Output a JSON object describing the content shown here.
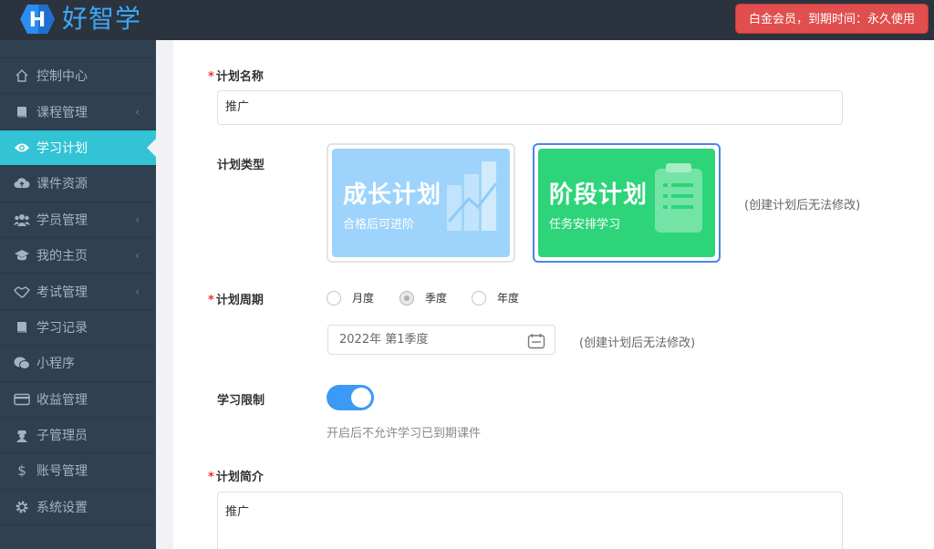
{
  "header": {
    "logo_letter": "H",
    "logo_text": "好智学",
    "member_status": "白金会员，到期时间：永久使用"
  },
  "sidebar": {
    "items": [
      {
        "label": "控制中心",
        "icon": "home-icon",
        "has_submenu": false,
        "active": false
      },
      {
        "label": "课程管理",
        "icon": "book-icon",
        "has_submenu": true,
        "active": false
      },
      {
        "label": "学习计划",
        "icon": "eye-icon",
        "has_submenu": false,
        "active": true
      },
      {
        "label": "课件资源",
        "icon": "cloud-icon",
        "has_submenu": false,
        "active": false
      },
      {
        "label": "学员管理",
        "icon": "users-icon",
        "has_submenu": true,
        "active": false
      },
      {
        "label": "我的主页",
        "icon": "graduation-cap-icon",
        "has_submenu": true,
        "active": false
      },
      {
        "label": "考试管理",
        "icon": "handshake-icon",
        "has_submenu": true,
        "active": false
      },
      {
        "label": "学习记录",
        "icon": "book-icon",
        "has_submenu": false,
        "active": false
      },
      {
        "label": "小程序",
        "icon": "wechat-icon",
        "has_submenu": false,
        "active": false
      },
      {
        "label": "收益管理",
        "icon": "credit-card-icon",
        "has_submenu": false,
        "active": false
      },
      {
        "label": "子管理员",
        "icon": "user-secret-icon",
        "has_submenu": false,
        "active": false
      },
      {
        "label": "账号管理",
        "icon": "dollar-icon",
        "has_submenu": false,
        "active": false
      },
      {
        "label": "系统设置",
        "icon": "gear-icon",
        "has_submenu": false,
        "active": false
      }
    ]
  },
  "form": {
    "plan_name": {
      "label": "计划名称",
      "value": "推广"
    },
    "plan_type": {
      "label": "计划类型",
      "hint": "(创建计划后无法修改)",
      "options": [
        {
          "title": "成长计划",
          "subtitle": "合格后可进阶",
          "selected": false
        },
        {
          "title": "阶段计划",
          "subtitle": "任务安排学习",
          "selected": true
        }
      ]
    },
    "plan_period": {
      "label": "计划周期",
      "options": [
        {
          "label": "月度",
          "checked": false
        },
        {
          "label": "季度",
          "checked": true
        },
        {
          "label": "年度",
          "checked": false
        }
      ],
      "date_value": "2022年 第1季度",
      "hint": "(创建计划后无法修改)"
    },
    "study_limit": {
      "label": "学习限制",
      "enabled": true,
      "hint": "开启后不允许学习已到期课件"
    },
    "plan_intro": {
      "label": "计划简介",
      "value": "推广"
    }
  },
  "colors": {
    "topbar": "#2b333f",
    "sidebar": "#2f4050",
    "active_item": "#32c3d4",
    "member_badge": "#e04e4e",
    "growth_card": "#9ed4fb",
    "stage_card": "#2ed47a",
    "toggle": "#3a9af5"
  }
}
